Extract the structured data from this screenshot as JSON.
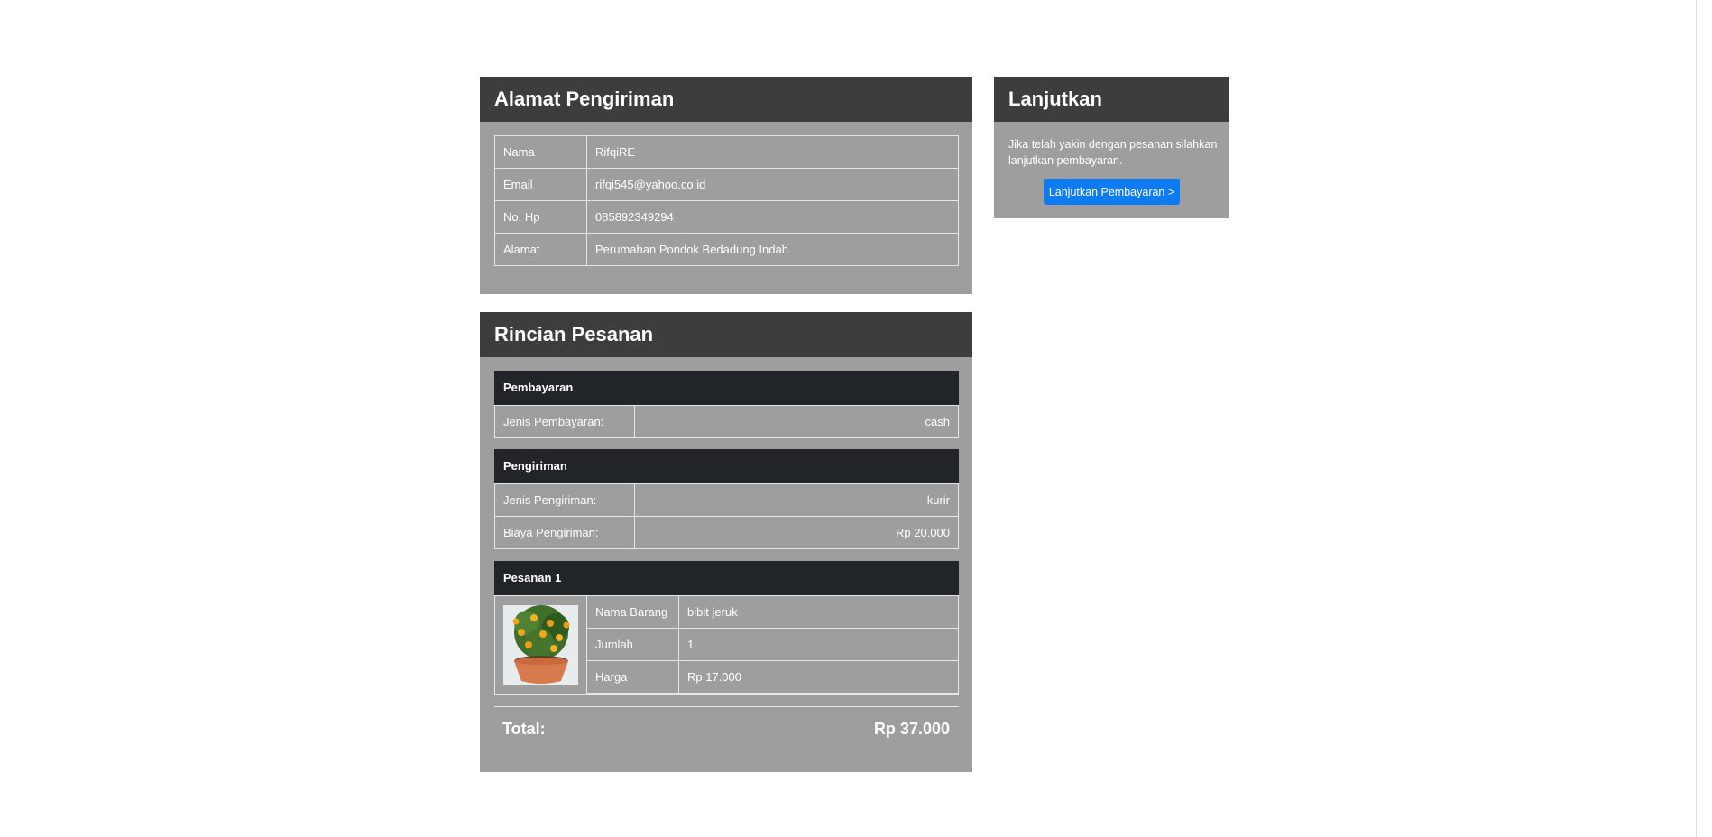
{
  "alamat": {
    "title": "Alamat Pengiriman",
    "rows": [
      {
        "label": "Nama",
        "value": "RifqiRE"
      },
      {
        "label": "Email",
        "value": "rifqi545@yahoo.co.id"
      },
      {
        "label": "No. Hp",
        "value": "085892349294"
      },
      {
        "label": "Alamat",
        "value": "Perumahan Pondok Bedadung Indah"
      }
    ]
  },
  "rincian": {
    "title": "Rincian Pesanan",
    "pembayaran": {
      "heading": "Pembayaran",
      "rows": [
        {
          "label": "Jenis Pembayaran:",
          "value": "cash"
        }
      ]
    },
    "pengiriman": {
      "heading": "Pengiriman",
      "rows": [
        {
          "label": "Jenis Pengiriman:",
          "value": "kurir"
        },
        {
          "label": "Biaya Pengiriman:",
          "value": "Rp 20.000"
        }
      ]
    },
    "pesanan": {
      "heading": "Pesanan 1",
      "image": "orange-tree-seedling-in-pot",
      "rows": [
        {
          "label": "Nama Barang",
          "value": "bibit jeruk"
        },
        {
          "label": "Jumlah",
          "value": "1"
        },
        {
          "label": "Harga",
          "value": "Rp 17.000"
        }
      ]
    },
    "total_label": "Total:",
    "total_value": "Rp 37.000"
  },
  "lanjutkan": {
    "title": "Lanjutkan",
    "text": "Jika telah yakin dengan pesanan silahkan lanjutkan pembayaran.",
    "button_label": "Lanjutkan Pembayaran >"
  },
  "colors": {
    "panel_bg": "#9e9e9e",
    "panel_header": "#3d3d3d",
    "section_head": "#212529",
    "button": "#0d7cf2"
  }
}
